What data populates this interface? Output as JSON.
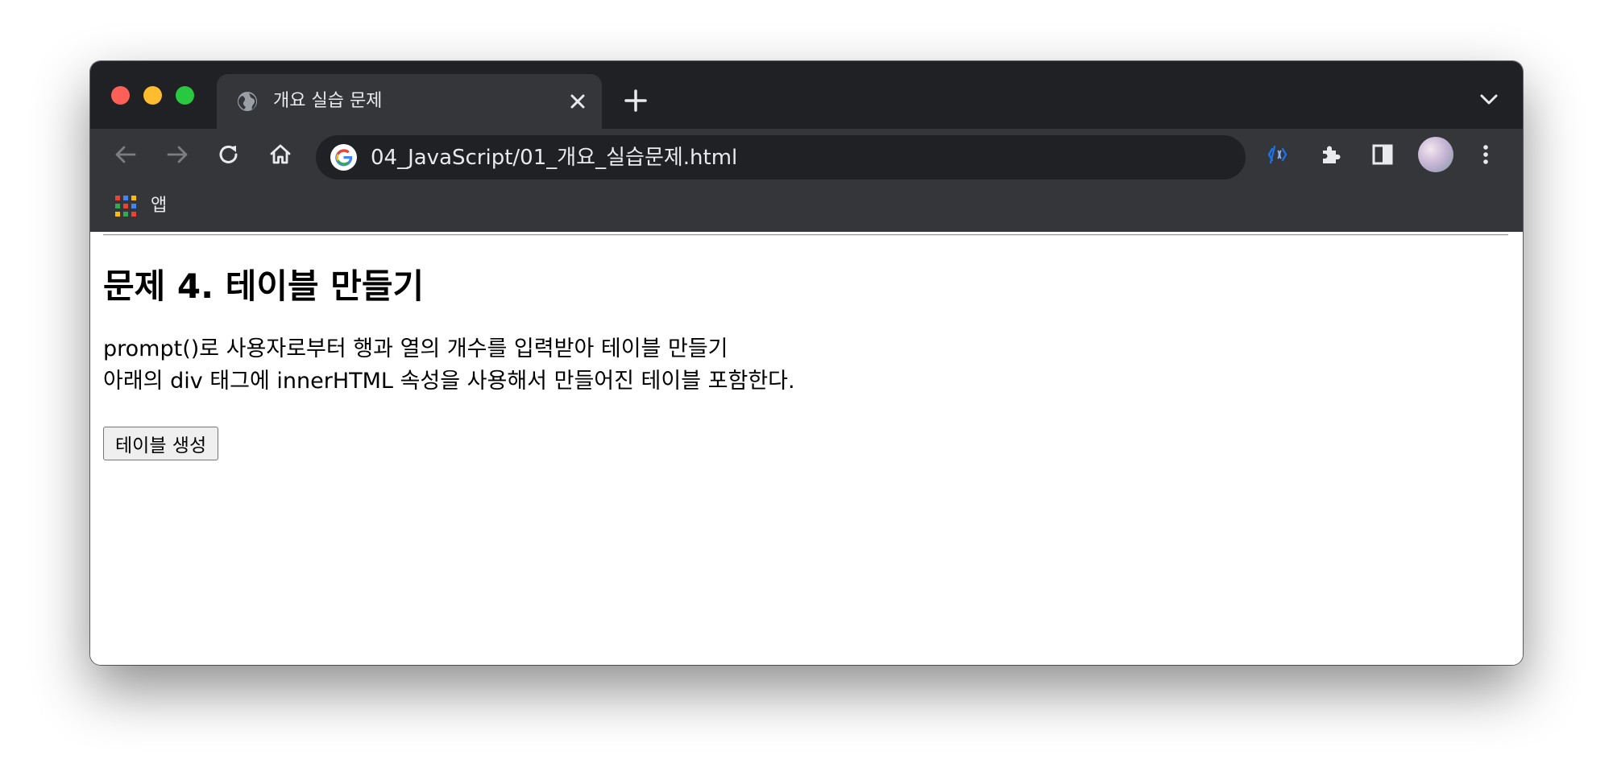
{
  "browser": {
    "tab": {
      "title": "개요 실습 문제"
    },
    "address_bar": {
      "url": "04_JavaScript/01_개요_실습문제.html"
    },
    "bookmarks": {
      "apps_label": "앱"
    },
    "colors": {
      "tabbar": "#202124",
      "toolbar": "#35363a",
      "omnibox": "#202124",
      "text": "#e8eaed",
      "icon_disabled": "#7b7d80",
      "extension_accent": "#1a73e8"
    }
  },
  "page": {
    "title": "문제 4. 테이블 만들기",
    "description_line1": "prompt()로 사용자로부터 행과 열의 개수를 입력받아 테이블 만들기",
    "description_line2": "아래의 div 태그에 innerHTML 속성을 사용해서 만들어진 테이블 포함한다.",
    "button_label": "테이블 생성"
  }
}
